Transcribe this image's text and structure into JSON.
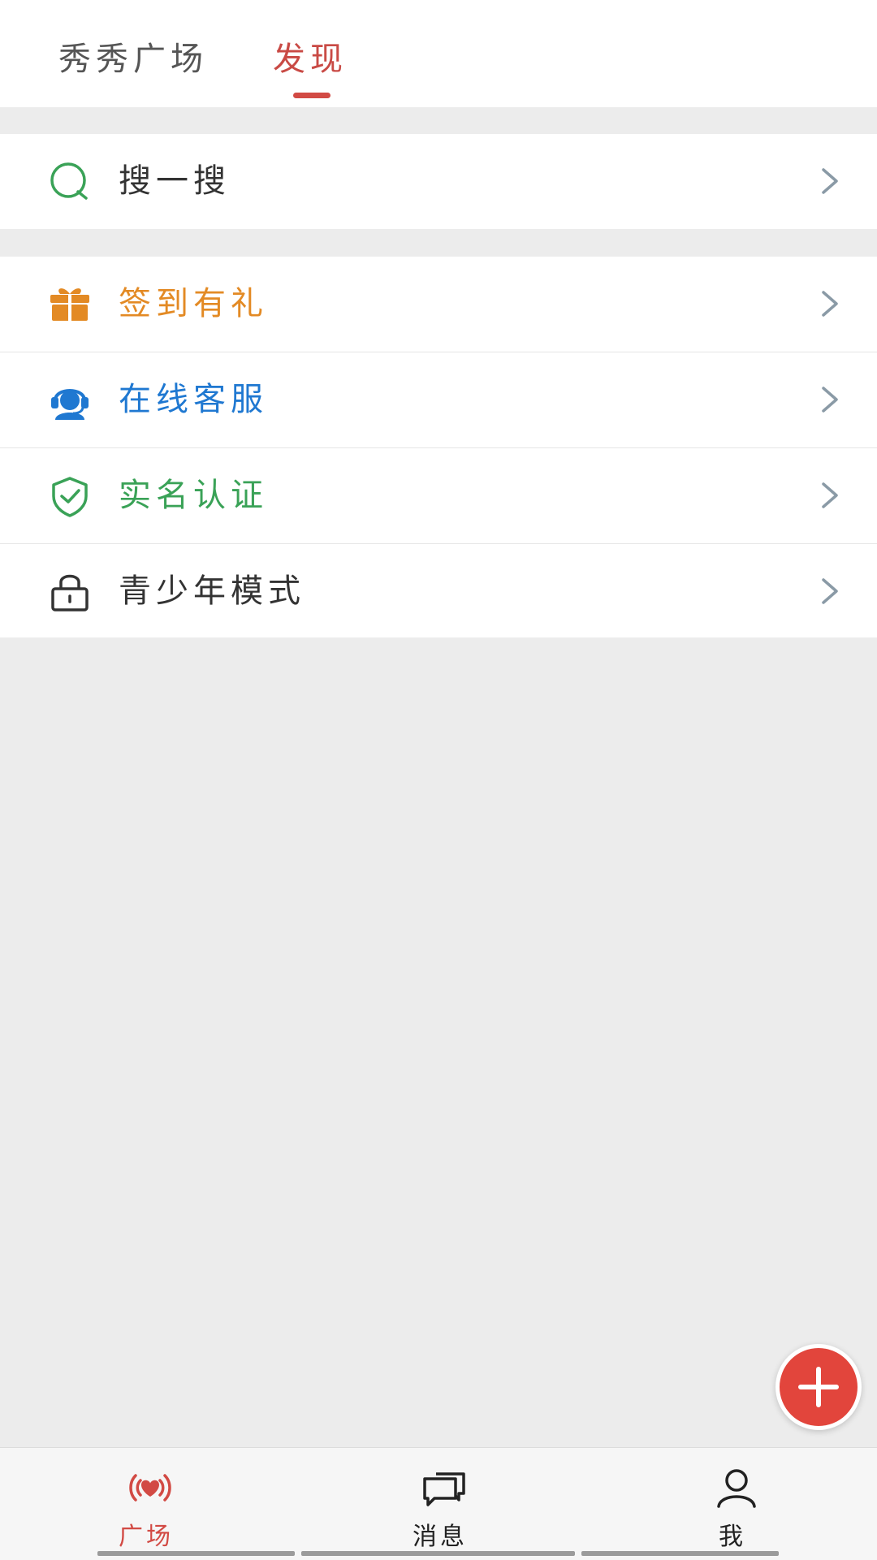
{
  "top_tabs": [
    {
      "label": "秀秀广场",
      "active": false
    },
    {
      "label": "发现",
      "active": true
    }
  ],
  "search_row": {
    "label": "搜一搜",
    "icon": "search-icon",
    "color": "#333333",
    "icon_color": "#3aa257"
  },
  "menu_rows": [
    {
      "label": "签到有礼",
      "icon": "gift-icon",
      "color": "#e38a24"
    },
    {
      "label": "在线客服",
      "icon": "customer-service-icon",
      "color": "#1f78d1"
    },
    {
      "label": "实名认证",
      "icon": "shield-check-icon",
      "color": "#3aa257"
    },
    {
      "label": "青少年模式",
      "icon": "lock-icon",
      "color": "#333333"
    }
  ],
  "fab": {
    "icon": "plus-icon",
    "color": "#e2453c"
  },
  "bottom_nav": [
    {
      "label": "广场",
      "icon": "broadcast-heart-icon",
      "active": true
    },
    {
      "label": "消息",
      "icon": "chat-bubbles-icon",
      "active": false
    },
    {
      "label": "我",
      "icon": "user-icon",
      "active": false
    }
  ],
  "colors": {
    "accent": "#d24a44",
    "chevron": "#8a9aa6",
    "page_background": "#ececec"
  }
}
